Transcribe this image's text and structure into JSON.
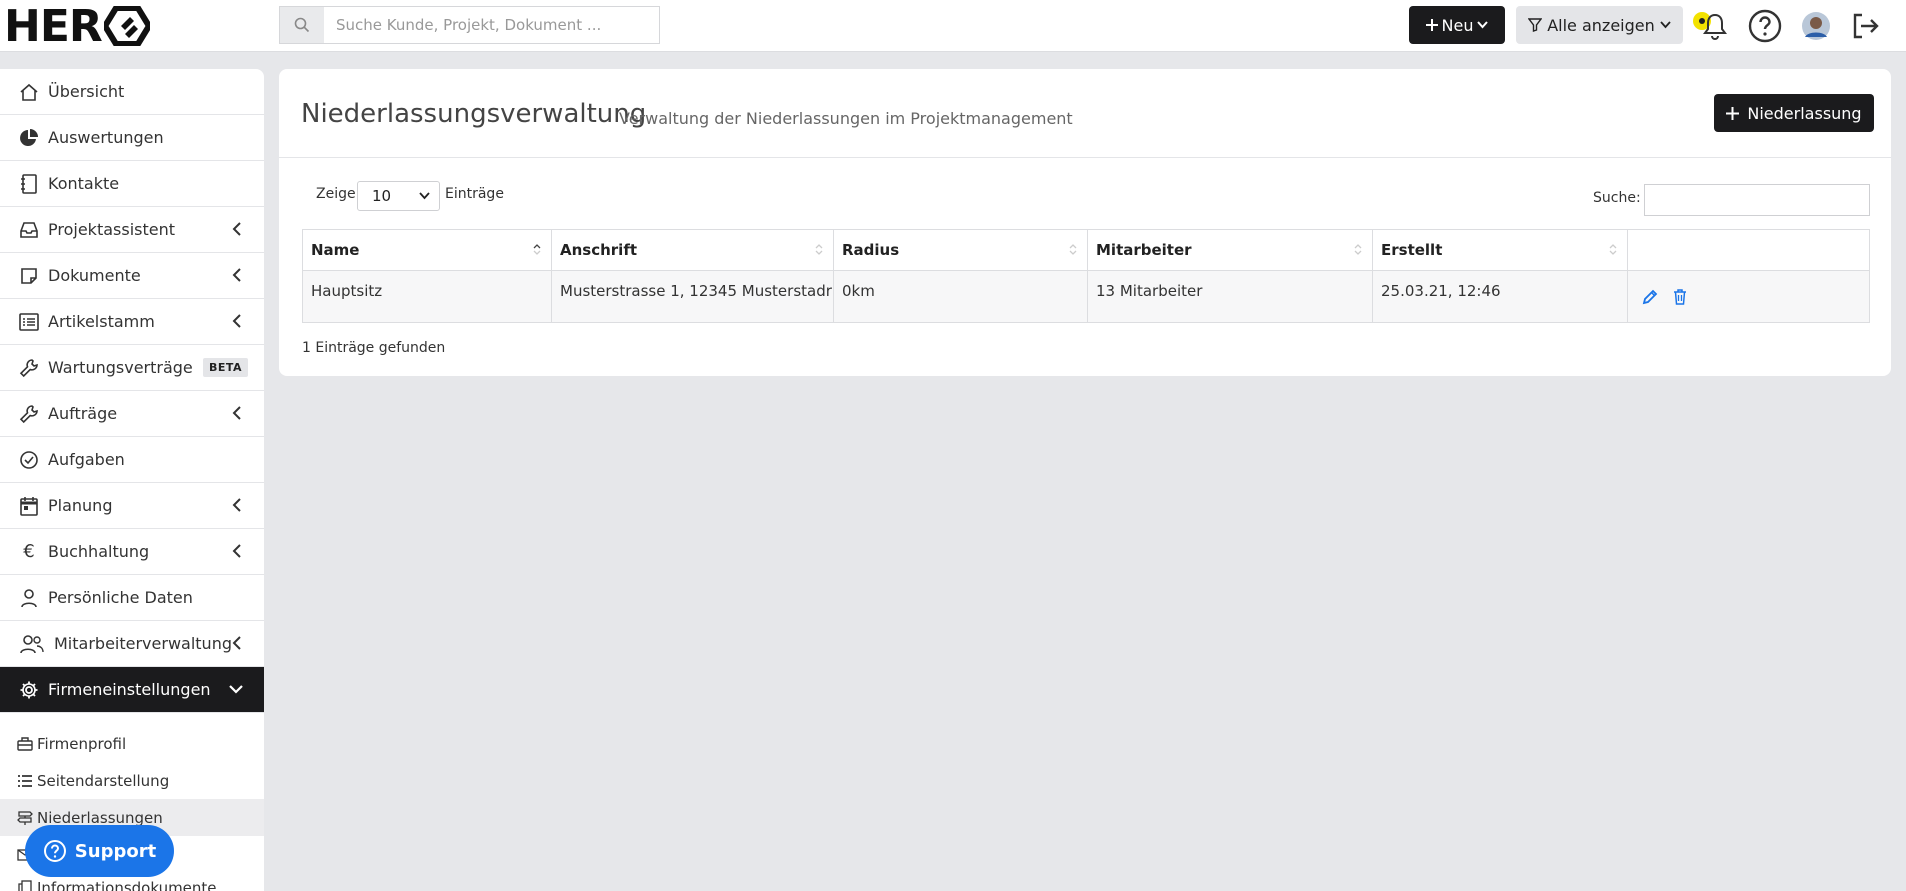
{
  "header": {
    "logo_text": "HER",
    "search_placeholder": "Suche Kunde, Projekt, Dokument ...",
    "new_button": "Neu",
    "filter_button": "Alle anzeigen"
  },
  "sidebar": {
    "items": [
      {
        "label": "Übersicht",
        "icon": "home-icon"
      },
      {
        "label": "Auswertungen",
        "icon": "pie-chart-icon"
      },
      {
        "label": "Kontakte",
        "icon": "address-book-icon"
      },
      {
        "label": "Projektassistent",
        "icon": "inbox-icon",
        "expandable": true
      },
      {
        "label": "Dokumente",
        "icon": "document-icon",
        "expandable": true
      },
      {
        "label": "Artikelstamm",
        "icon": "list-icon",
        "expandable": true
      },
      {
        "label": "Wartungsverträge",
        "icon": "wrench-icon",
        "badge": "BETA"
      },
      {
        "label": "Aufträge",
        "icon": "wrench-icon",
        "expandable": true
      },
      {
        "label": "Aufgaben",
        "icon": "check-circle-icon"
      },
      {
        "label": "Planung",
        "icon": "calendar-icon",
        "expandable": true
      },
      {
        "label": "Buchhaltung",
        "icon": "euro-icon",
        "expandable": true
      },
      {
        "label": "Persönliche Daten",
        "icon": "user-icon"
      },
      {
        "label": "Mitarbeiterverwaltung",
        "icon": "users-icon",
        "expandable": true
      },
      {
        "label": "Firmeneinstellungen",
        "icon": "gear-icon",
        "expanded": true
      }
    ],
    "subitems": [
      {
        "label": "Firmenprofil",
        "icon": "briefcase-icon"
      },
      {
        "label": "Seitendarstellung",
        "icon": "list-icon"
      },
      {
        "label": "Niederlassungen",
        "icon": "signpost-icon"
      },
      {
        "label": "",
        "icon": "mail-icon"
      },
      {
        "label": "Informationsdokumente",
        "icon": "copy-icon"
      }
    ],
    "support_label": "Support"
  },
  "main": {
    "title": "Niederlassungsverwaltung",
    "subtitle": "Verwaltung der Niederlassungen im Projektmanagement",
    "add_button": "Niederlassung",
    "length_prefix": "Zeige",
    "length_value": "10",
    "length_suffix": "Einträge",
    "search_label": "Suche:",
    "columns": [
      "Name",
      "Anschrift",
      "Radius",
      "Mitarbeiter",
      "Erstellt"
    ],
    "rows": [
      {
        "name": "Hauptsitz",
        "address": "Musterstrasse 1, 12345 Musterstadr",
        "radius": "0km",
        "employees": "13 Mitarbeiter",
        "created": "25.03.21, 12:46"
      }
    ],
    "footer": "1 Einträge gefunden"
  }
}
